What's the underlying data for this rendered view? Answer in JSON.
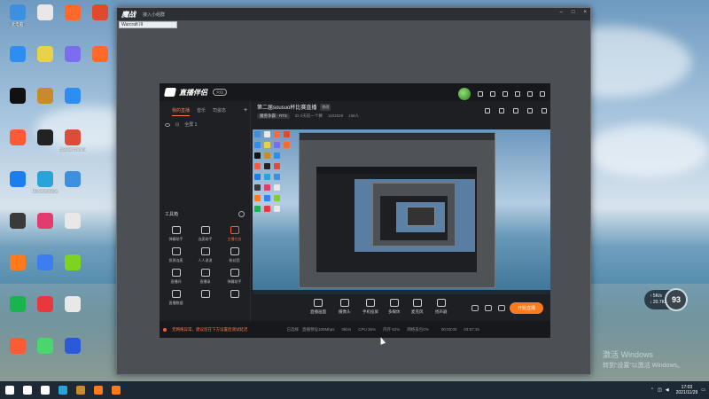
{
  "desktop": {
    "icons": [
      {
        "label": "此电脑",
        "color": "#3d8fe0"
      },
      {
        "label": "",
        "color": "#e8e8e8"
      },
      {
        "label": "",
        "color": "#ff6a2b"
      },
      {
        "label": "",
        "color": "#e04a2b"
      },
      {
        "label": "",
        "color": "#2d8df0"
      },
      {
        "label": "",
        "color": "#e8d24a"
      },
      {
        "label": "",
        "color": "#7c6cf0"
      },
      {
        "label": "",
        "color": "#ff6a2b"
      },
      {
        "label": "",
        "color": "#111"
      },
      {
        "label": "",
        "color": "#c98a2b"
      },
      {
        "label": "",
        "color": "#2d8df0"
      },
      {
        "label": "",
        "color": ""
      },
      {
        "label": "",
        "color": "#ff5a36"
      },
      {
        "label": "",
        "color": "#222"
      },
      {
        "label": "Google Chrome",
        "color": "#dd4b39"
      },
      {
        "label": "",
        "color": ""
      },
      {
        "label": "",
        "color": "#1a7ef0"
      },
      {
        "label": "Microsoft Edge",
        "color": "#2aa4d8"
      },
      {
        "label": "",
        "color": "#3d8fe0"
      },
      {
        "label": "",
        "color": ""
      },
      {
        "label": "",
        "color": "#3a3a3a"
      },
      {
        "label": "",
        "color": "#e23c6e"
      },
      {
        "label": "",
        "color": "#e8e8e8"
      },
      {
        "label": "",
        "color": ""
      },
      {
        "label": "",
        "color": "#ff7a1a"
      },
      {
        "label": "",
        "color": "#3a7ef0"
      },
      {
        "label": "",
        "color": "#7ed321"
      },
      {
        "label": "",
        "color": ""
      },
      {
        "label": "",
        "color": "#19b44e"
      },
      {
        "label": "",
        "color": "#e8373d"
      },
      {
        "label": "",
        "color": "#e8e8e8"
      },
      {
        "label": "",
        "color": ""
      },
      {
        "label": "",
        "color": "#ff5a36"
      },
      {
        "label": "",
        "color": "#4ad66d"
      },
      {
        "label": "",
        "color": "#2a5ad8"
      },
      {
        "label": "",
        "color": ""
      }
    ],
    "watermark_line1": "激活 Windows",
    "watermark_line2": "转到“设置”以激活 Windows。",
    "perf_percent": "93",
    "perf_up": "↑ 5K/s",
    "perf_down": "↓ 20.7K/s"
  },
  "taskbar": {
    "time": "17:03",
    "date": "2021/11/29",
    "items": [
      {
        "name": "start",
        "color": "#ffffff"
      },
      {
        "name": "search",
        "color": "#ffffff"
      },
      {
        "name": "task-view",
        "color": "#ffffff"
      },
      {
        "name": "edge",
        "color": "#2aa4d8"
      },
      {
        "name": "warcraft",
        "color": "#c98a2b"
      },
      {
        "name": "app-1",
        "color": "#ff7a1a"
      },
      {
        "name": "app-2",
        "color": "#ff7a1a"
      }
    ]
  },
  "outer_window": {
    "title": "魔战",
    "subtitle": "接入小组群",
    "tab_label": "Warcraft III"
  },
  "app": {
    "logo": "直播伴侣",
    "version_tag": "火山",
    "left_tabs": [
      "我的直播",
      "音乐",
      "司姿态"
    ],
    "add_tab": "+",
    "scene_label": "全屏 1",
    "tools_title": "工具箱",
    "tools": [
      {
        "label": "弹幕助手",
        "hot": false
      },
      {
        "label": "连麦助手",
        "hot": false
      },
      {
        "label": "主播任务",
        "hot": true
      },
      {
        "label": "投屏连麦",
        "hot": false
      },
      {
        "label": "人人说说",
        "hot": false
      },
      {
        "label": "粉丝团",
        "hot": false
      },
      {
        "label": "直播间",
        "hot": false
      },
      {
        "label": "直播录",
        "hot": false
      },
      {
        "label": "弹幕助手",
        "hot": false
      },
      {
        "label": "直播数据",
        "hot": false
      },
      {
        "label": "",
        "hot": false
      },
      {
        "label": "",
        "hot": false
      }
    ],
    "stream_title": "第二届sousuo杯比赛直播",
    "stream_tag": "修改",
    "category": "魔兽争霸 · RTS",
    "sub1": "ID·2天前一个赛",
    "sub2": "1102528",
    "sub3": "158人",
    "controls": [
      {
        "label": "直播画面"
      },
      {
        "label": "摄像头"
      },
      {
        "label": "手机投屏"
      },
      {
        "label": "多媒体"
      },
      {
        "label": "麦克风"
      },
      {
        "label": "扬声器"
      }
    ],
    "live_button": "开始直播",
    "status_warn": "无网络异常，建议您在下方设置后测试延迟",
    "status_a": "已选择",
    "status_b": "直播预设100Mbps",
    "status_c": "0kb/s",
    "status_d": "CPU 35%",
    "status_e": "内存 52%",
    "status_f": "网络丢包0%",
    "live_time": "00:00:00",
    "clock": "03:57:16"
  }
}
